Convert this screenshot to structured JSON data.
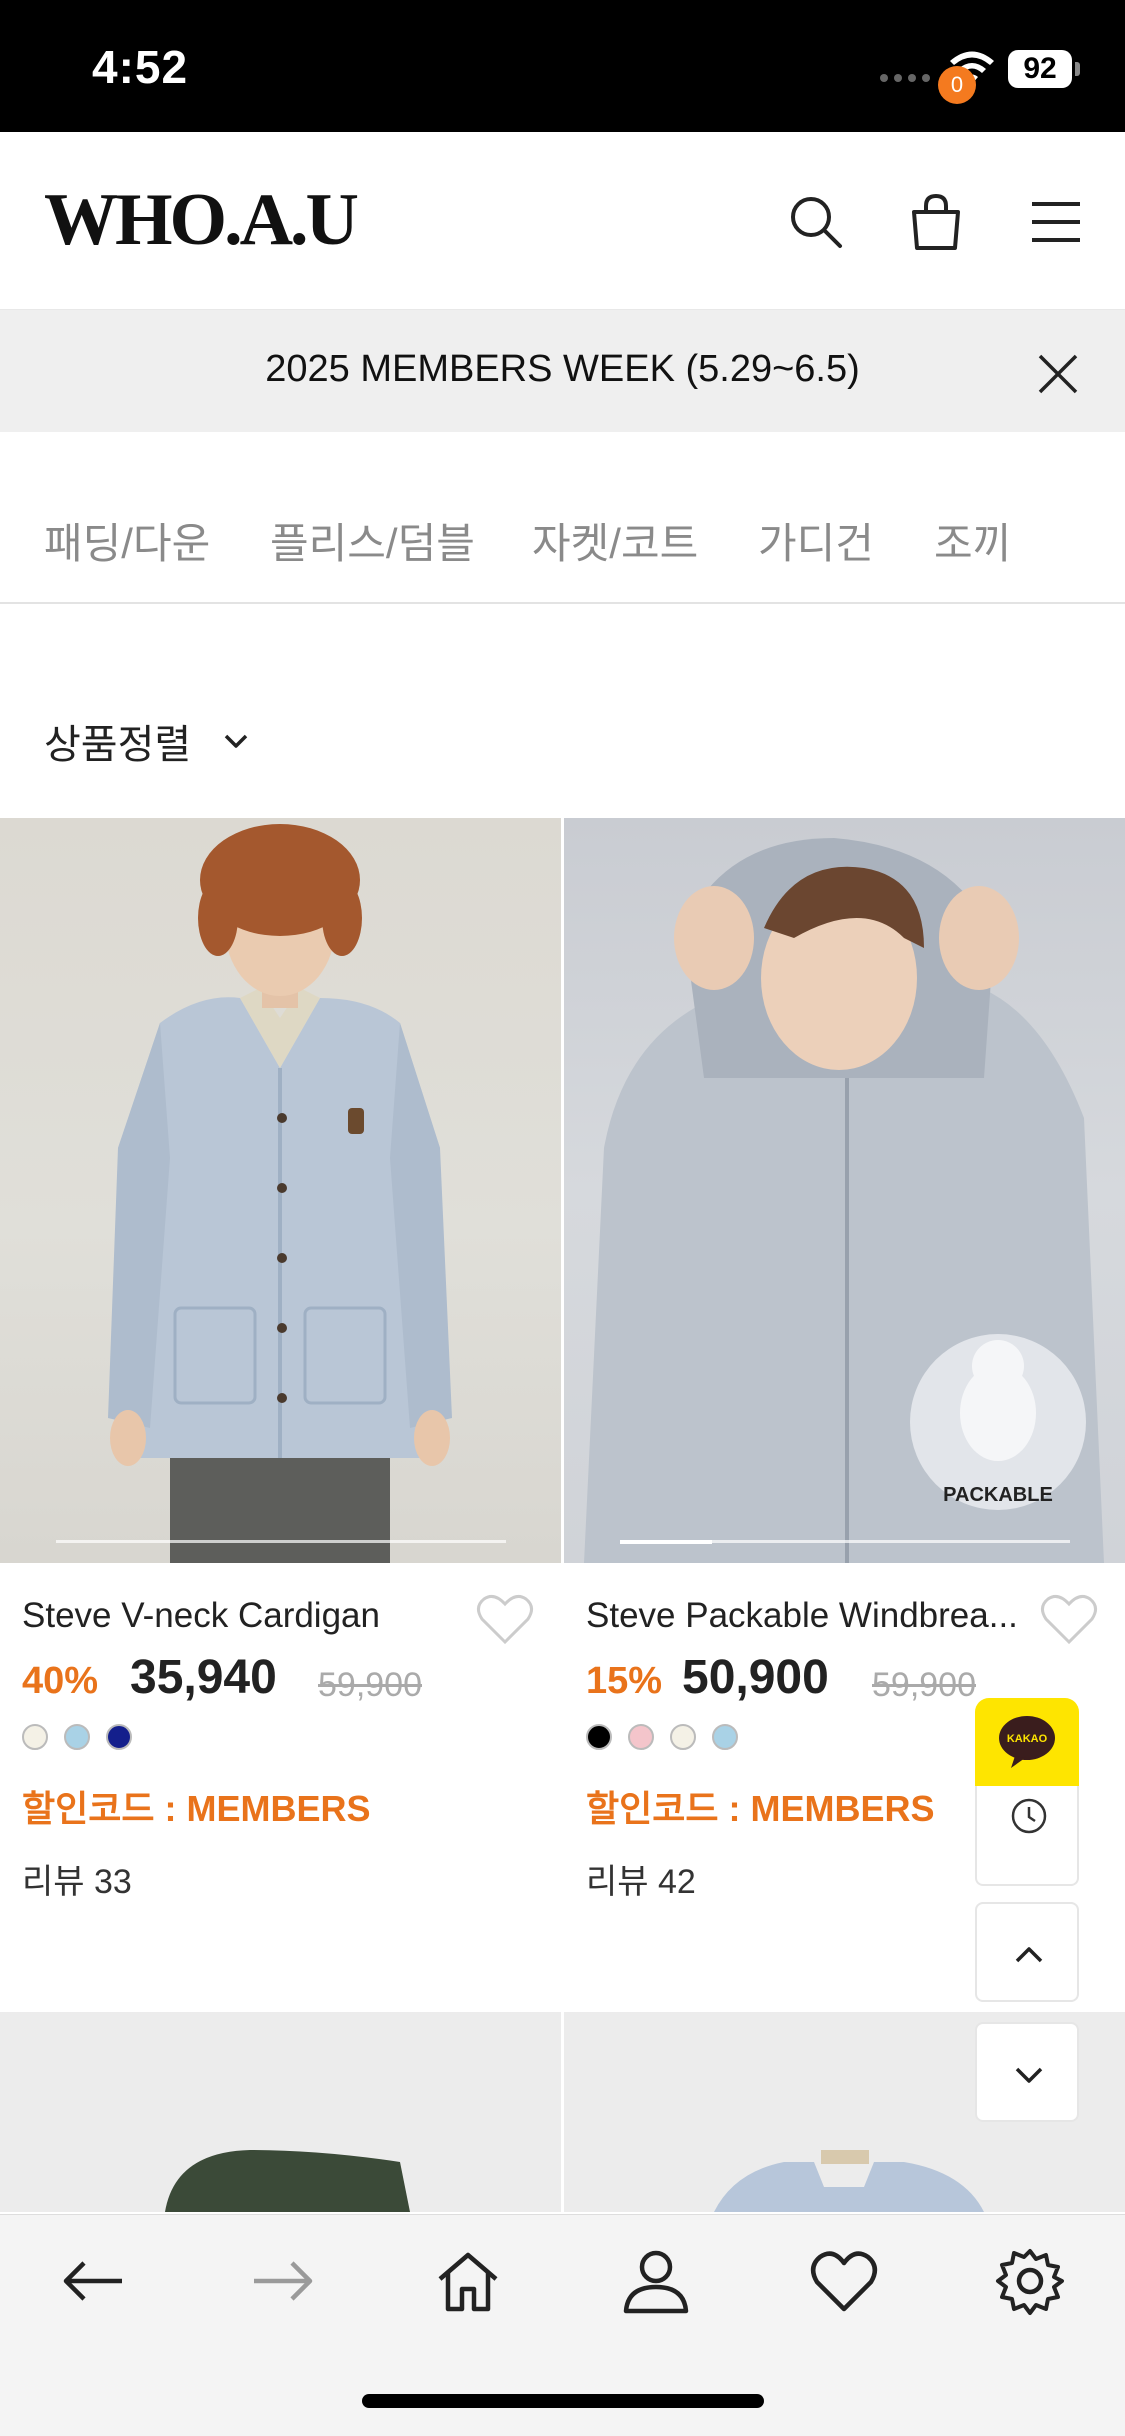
{
  "status_bar": {
    "time": "4:52",
    "battery": "92"
  },
  "header": {
    "logo": "WHO.A.U",
    "cart_count": "0"
  },
  "banner": {
    "text": "2025 MEMBERS WEEK (5.29~6.5)"
  },
  "categories": [
    "패딩/다운",
    "플리스/덤블",
    "자켓/코트",
    "가디건",
    "조끼"
  ],
  "sort": {
    "label": "상품정렬"
  },
  "products": [
    {
      "name": "Steve V-neck Cardigan",
      "discount": "40%",
      "price": "35,940",
      "original_price": "59,900",
      "colors": [
        "#f4f1e6",
        "#a9d2e6",
        "#141f8c"
      ],
      "code": "할인코드 : MEMBERS",
      "review": "리뷰 33"
    },
    {
      "name": "Steve Packable Windbrea...",
      "discount": "15%",
      "price": "50,900",
      "original_price": "59,900",
      "colors": [
        "#000000",
        "#f4c5cb",
        "#f4f1e6",
        "#a9d2e6"
      ],
      "code": "할인코드 : MEMBERS",
      "review": "리뷰 42",
      "badge": "PACKABLE"
    }
  ],
  "floating": {
    "kakao": "KAKAO"
  },
  "colors": {
    "accent": "#e9731b",
    "badge": "#f47a1f",
    "kakao": "#fee500"
  }
}
